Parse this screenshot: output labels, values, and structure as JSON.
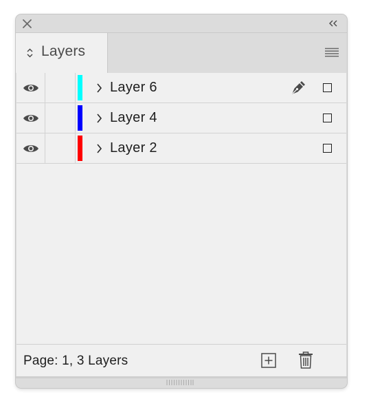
{
  "panel": {
    "tab_label": "Layers",
    "close_icon": "close-icon",
    "collapse_icon": "double-chevron-left-icon",
    "menu_icon": "panel-menu-icon"
  },
  "layers": [
    {
      "name": "Layer 6",
      "color": "#00ffff",
      "visible": true,
      "active": true
    },
    {
      "name": "Layer 4",
      "color": "#0000ff",
      "visible": true,
      "active": false
    },
    {
      "name": "Layer 2",
      "color": "#ff0000",
      "visible": true,
      "active": false
    }
  ],
  "footer": {
    "status": "Page: 1, 3 Layers",
    "new_layer_icon": "new-layer-icon",
    "delete_icon": "trash-icon"
  },
  "colors": {
    "panel_bg": "#f0f0f0",
    "chrome_bg": "#dcdcdc",
    "text": "#1e1e1e"
  }
}
